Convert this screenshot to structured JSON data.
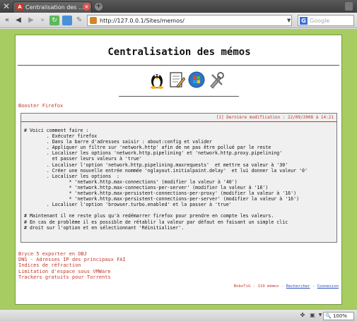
{
  "browser": {
    "tab_title": "Centralisation des ...",
    "tab_close": "×",
    "new_tab": "+",
    "url": "http://127.0.0.1/Sites/memos/",
    "search_placeholder": "Google",
    "zoom": "100%"
  },
  "page": {
    "title": "Centralisation des mémos",
    "icons": [
      "tux-penguin-icon",
      "notepad-pencil-icon",
      "windows-orb-icon",
      "tools-icon"
    ],
    "section_title": "Booster Firefox",
    "memo": {
      "modification": "[1] Dernière modification : 22/09/2008 à 14:21",
      "lines": [
        "# Voici comment faire :",
        "        . Exécuter firefox",
        "        . Dans la barre d'adresses saisir : about:config et valider",
        "        . Appliquer un filtre sur 'network.http' afin de ne pas être pollué par le reste",
        "        . Localiser les options 'network.http.pipelining' et 'network.http.proxy.pipelining'",
        "          et passer leurs valeurs à 'true'",
        "        . Localiser l'option 'network.http.pipelining.maxrequests'  et mettre sa valeur à '30'",
        "        . Créer une nouvelle entrée nommée 'nglayout.initialpaint.delay'  et lui donner la valeur '0'",
        "        . Localiser les options  :",
        "                * 'network.http.max-connections' (modifier la valeur à '40')",
        "                * 'network.http.max-connections-per-server' (modifier la valeur à '16')",
        "                * 'network.http.max-persistent-connections-per-proxy' (modifier la valeur à '16')",
        "                * 'network.http.max-persistent-connections-per-server' (modifier la valeur à '16')",
        "        . Localiser l'option 'browser.turbo.enabled' et la passer à 'true'",
        "",
        "# Maintenant il ne reste plus qu'à redémarrer firefox pour prendre en compte les valeurs.",
        "# En cas de problème il es possible de rétablir la valeur par défaut en faisant un simple clic",
        "# droit sur l'option et en sélectionnant 'Réinitialiser'."
      ]
    },
    "links": [
      "Bryce 5 exporter en OBJ",
      "DNS - Adresses IP des principaux FAI",
      "Indices de réfraction",
      "Limitation d'espace sous VMWare",
      "Trackers gratuits pour Torrents"
    ],
    "footer": {
      "info": "BoboTiG - 119 mémos - ",
      "search": "Rechercher",
      "sep": " - ",
      "login": "Connexion"
    }
  },
  "colors": {
    "page_bg": "#a6cc62",
    "accent_red": "#c0392b",
    "link_blue": "#2a4fb5"
  }
}
